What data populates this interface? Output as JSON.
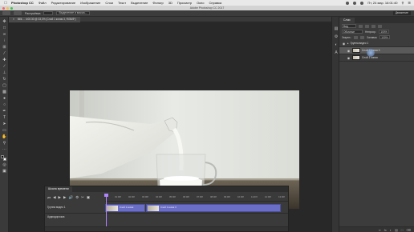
{
  "menubar": {
    "app_name": "Photoshop CC",
    "items": [
      "Файл",
      "Редактирование",
      "Изображение",
      "Слои",
      "Текст",
      "Выделение",
      "Фильтр",
      "3D",
      "Просмотр",
      "Окно",
      "Справка"
    ],
    "clock": "Пт, 24 мар. 16:01:40"
  },
  "window": {
    "title": "Adobe Photoshop CC 2017"
  },
  "options": {
    "feather": "Растушёвка",
    "refine": "Выделение и маска...",
    "workspace": "Движение"
  },
  "document": {
    "tab_title": "Milk ... 4:00:30 @ 33,3% (Слой 1 копия 3, RGB/8*)"
  },
  "layers_panel": {
    "tab_label": "Слои",
    "kind_label": "Вид",
    "blend_mode": "Обычные",
    "opacity_label": "Непрозр.:",
    "opacity_value": "100%",
    "lock_label": "Закреп.:",
    "fill_label": "Заливка:",
    "fill_value": "100%",
    "layers": [
      {
        "name": "Группа видео 1",
        "selected": false,
        "group": true
      },
      {
        "name": "Слой 1 копия 3",
        "selected": true,
        "group": false
      },
      {
        "name": "Слой 1 копия",
        "selected": false,
        "group": false
      }
    ]
  },
  "timeline": {
    "tab_label": "Шкала времени",
    "ruler_ticks": [
      "01:00f",
      "02:00f",
      "03:00f",
      "04:00f",
      "05:00f",
      "06:00f",
      "07:00f",
      "08:00f",
      "09:00f",
      "10:00f",
      "11:00f",
      "12:00f",
      "13:00f"
    ],
    "video_track": "Группа видео 1",
    "clips": [
      "Слой 1 копия",
      "Слой 1 копия 3"
    ],
    "audio_track": "Аудиодорожка"
  },
  "colors": {
    "accent": "#6b6ec5",
    "playhead": "#b084ff"
  }
}
